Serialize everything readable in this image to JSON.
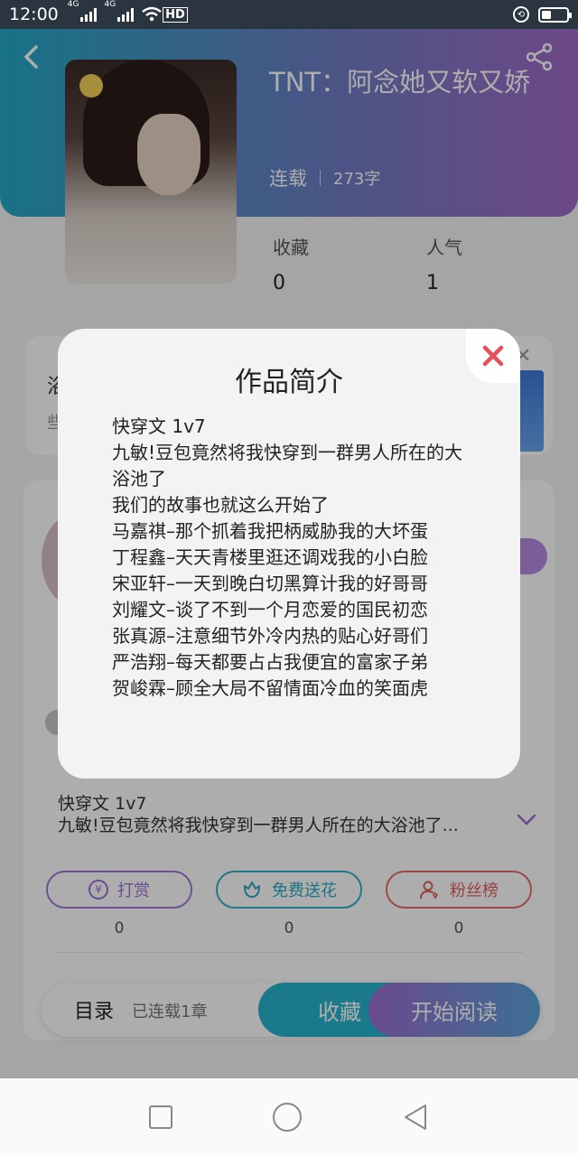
{
  "status_bar": {
    "time": "12:00",
    "sim1_tag": "4G",
    "sim2_tag": "4G",
    "hd_badge": "HD"
  },
  "book": {
    "title": "TNT：阿念她又软又娇",
    "status": "连载",
    "word_count": "273字",
    "stats": [
      {
        "label": "收藏",
        "value": "0"
      },
      {
        "label": "人气",
        "value": "1"
      }
    ]
  },
  "intro_preview": {
    "line1": "快穿文  1v7",
    "line2": "九敏!豆包竟然将我快穿到一群男人所在的大浴池了..."
  },
  "actions": [
    {
      "label": "打赏",
      "count": "0",
      "icon": "yen-icon"
    },
    {
      "label": "免费送花",
      "count": "0",
      "icon": "flower-icon"
    },
    {
      "label": "粉丝榜",
      "count": "0",
      "icon": "fans-icon"
    }
  ],
  "bottom_bar": {
    "toc_label": "目录",
    "chapters_label": "已连载1章",
    "favorite_label": "收藏",
    "read_label": "开始阅读"
  },
  "modal": {
    "title": "作品简介",
    "lines": [
      "快穿文  1v7",
      "九敏!豆包竟然将我快穿到一群男人所在的大浴池了",
      "我们的故事也就这么开始了",
      "马嘉祺–那个抓着我把柄威胁我的大坏蛋",
      "丁程鑫–天天青楼里逛还调戏我的小白脸",
      "宋亚轩–一天到晚白切黑算计我的好哥哥",
      "刘耀文–谈了不到一个月恋爱的国民初恋",
      "张真源–注意细节外冷内热的贴心好哥们",
      "严浩翔–每天都要占占我便宜的富家子弟",
      "贺峻霖–顾全大局不留情面冷血的笑面虎"
    ]
  },
  "colors": {
    "accent_cyan": "#28b3cf",
    "accent_purple": "#9e6fd2",
    "close_red": "#e8505b"
  }
}
